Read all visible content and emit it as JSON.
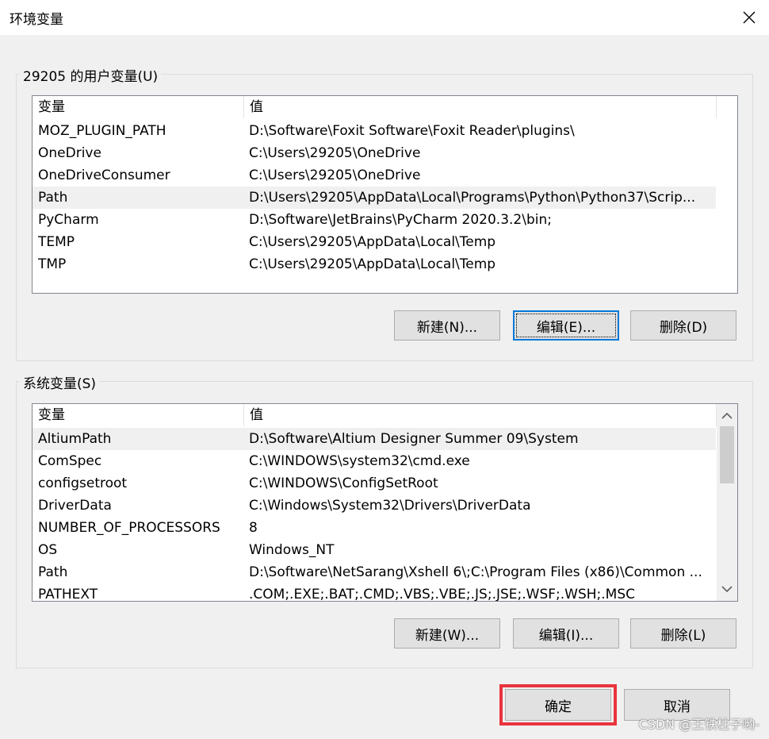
{
  "window": {
    "title": "环境变量"
  },
  "user_vars": {
    "legend": "29205 的用户变量(U)",
    "columns": [
      "变量",
      "值"
    ],
    "rows": [
      {
        "name": "MOZ_PLUGIN_PATH",
        "value": "D:\\Software\\Foxit Software\\Foxit Reader\\plugins\\"
      },
      {
        "name": "OneDrive",
        "value": "C:\\Users\\29205\\OneDrive"
      },
      {
        "name": "OneDriveConsumer",
        "value": "C:\\Users\\29205\\OneDrive"
      },
      {
        "name": "Path",
        "value": "D:\\Users\\29205\\AppData\\Local\\Programs\\Python\\Python37\\Scrip..."
      },
      {
        "name": "PyCharm",
        "value": "D:\\Software\\JetBrains\\PyCharm 2020.3.2\\bin;"
      },
      {
        "name": "TEMP",
        "value": "C:\\Users\\29205\\AppData\\Local\\Temp"
      },
      {
        "name": "TMP",
        "value": "C:\\Users\\29205\\AppData\\Local\\Temp"
      }
    ],
    "selected_index": 3,
    "buttons": {
      "new": "新建(N)...",
      "edit": "编辑(E)...",
      "delete": "删除(D)"
    }
  },
  "system_vars": {
    "legend": "系统变量(S)",
    "columns": [
      "变量",
      "值"
    ],
    "rows": [
      {
        "name": "AltiumPath",
        "value": "D:\\Software\\Altium Designer Summer 09\\System"
      },
      {
        "name": "ComSpec",
        "value": "C:\\WINDOWS\\system32\\cmd.exe"
      },
      {
        "name": "configsetroot",
        "value": "C:\\WINDOWS\\ConfigSetRoot"
      },
      {
        "name": "DriverData",
        "value": "C:\\Windows\\System32\\Drivers\\DriverData"
      },
      {
        "name": "NUMBER_OF_PROCESSORS",
        "value": "8"
      },
      {
        "name": "OS",
        "value": "Windows_NT"
      },
      {
        "name": "Path",
        "value": "D:\\Software\\NetSarang\\Xshell 6\\;C:\\Program Files (x86)\\Common ..."
      },
      {
        "name": "PATHEXT",
        "value": ".COM;.EXE;.BAT;.CMD;.VBS;.VBE;.JS;.JSE;.WSF;.WSH;.MSC"
      }
    ],
    "selected_index": 0,
    "buttons": {
      "new": "新建(W)...",
      "edit": "编辑(I)...",
      "delete": "删除(L)"
    }
  },
  "footer": {
    "ok": "确定",
    "cancel": "取消"
  },
  "watermark": "CSDN @王铁柱子哟-",
  "colors": {
    "highlight": "#e8343d",
    "focus": "#0078d7"
  }
}
